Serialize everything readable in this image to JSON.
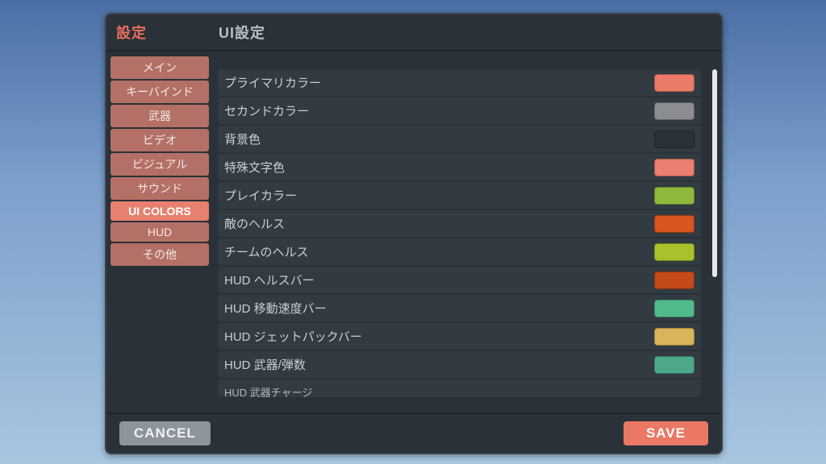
{
  "header": {
    "settings_label": "設定",
    "panel_title": "UI設定"
  },
  "sidebar": {
    "items": [
      {
        "label": "メイン",
        "active": false
      },
      {
        "label": "キーバインド",
        "active": false
      },
      {
        "label": "武器",
        "active": false
      },
      {
        "label": "ビデオ",
        "active": false
      },
      {
        "label": "ビジュアル",
        "active": false
      },
      {
        "label": "サウンド",
        "active": false
      },
      {
        "label": "UI COLORS",
        "active": true
      },
      {
        "label": "HUD",
        "active": false
      },
      {
        "label": "その他",
        "active": false
      }
    ]
  },
  "rows": [
    {
      "label": "プライマリカラー",
      "color": "#eb7a68"
    },
    {
      "label": "セカンドカラー",
      "color": "#8b8d90"
    },
    {
      "label": "背景色",
      "color": "#2b3138"
    },
    {
      "label": "特殊文字色",
      "color": "#eb7e6e"
    },
    {
      "label": "プレイカラー",
      "color": "#8fb93c"
    },
    {
      "label": "敵のヘルス",
      "color": "#d9541f"
    },
    {
      "label": "チームのヘルス",
      "color": "#a9c22c"
    },
    {
      "label": "HUD ヘルスバー",
      "color": "#c44a1c"
    },
    {
      "label": "HUD 移動速度バー",
      "color": "#52ba8a"
    },
    {
      "label": "HUD ジェットパックバー",
      "color": "#d8b45a"
    },
    {
      "label": "HUD 武器/弾数",
      "color": "#4da88a"
    },
    {
      "label": "HUD 武器チャージ",
      "color": "#4da88a"
    }
  ],
  "footer": {
    "cancel_label": "CANCEL",
    "save_label": "SAVE"
  }
}
